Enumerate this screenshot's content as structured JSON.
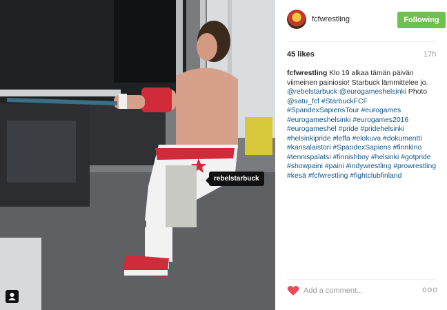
{
  "post": {
    "photo_alt": "",
    "photo_tag": "rebelstarbuck"
  },
  "header": {
    "username": "fcfwrestling",
    "follow_label": "Following"
  },
  "stats": {
    "likes": "45 likes",
    "time": "17h"
  },
  "caption": {
    "username": "fcfwrestling",
    "segments": [
      {
        "t": "text",
        "v": " Klo 19 alkaa tämän päivän viimeinen painiosio! Starbuck lämmittelee jo. "
      },
      {
        "t": "link",
        "v": "@rebelstarbuck"
      },
      {
        "t": "text",
        "v": " "
      },
      {
        "t": "link",
        "v": "@eurogameshelsinki"
      },
      {
        "t": "text",
        "v": " Photo "
      },
      {
        "t": "link",
        "v": "@satu_fcf"
      },
      {
        "t": "text",
        "v": " "
      },
      {
        "t": "link",
        "v": "#StarbuckFCF"
      },
      {
        "t": "text",
        "v": " "
      },
      {
        "t": "link",
        "v": "#SpandexSapiensTour"
      },
      {
        "t": "text",
        "v": " "
      },
      {
        "t": "link",
        "v": "#eurogames"
      },
      {
        "t": "text",
        "v": " "
      },
      {
        "t": "link",
        "v": "#eurogameshelsinki"
      },
      {
        "t": "text",
        "v": " "
      },
      {
        "t": "link",
        "v": "#eurogames2016"
      },
      {
        "t": "text",
        "v": " "
      },
      {
        "t": "link",
        "v": "#eurogameshel"
      },
      {
        "t": "text",
        "v": " "
      },
      {
        "t": "link",
        "v": "#pride"
      },
      {
        "t": "text",
        "v": " "
      },
      {
        "t": "link",
        "v": "#pridehelsinki"
      },
      {
        "t": "text",
        "v": " "
      },
      {
        "t": "link",
        "v": "#helsinkipride"
      },
      {
        "t": "text",
        "v": " "
      },
      {
        "t": "link",
        "v": "#leffa"
      },
      {
        "t": "text",
        "v": " "
      },
      {
        "t": "link",
        "v": "#elokuva"
      },
      {
        "t": "text",
        "v": " "
      },
      {
        "t": "link",
        "v": "#dokumentti"
      },
      {
        "t": "text",
        "v": " "
      },
      {
        "t": "link",
        "v": "#kansalaistori"
      },
      {
        "t": "text",
        "v": " "
      },
      {
        "t": "link",
        "v": "#SpandexSapiens"
      },
      {
        "t": "text",
        "v": " "
      },
      {
        "t": "link",
        "v": "#finnkino"
      },
      {
        "t": "text",
        "v": " "
      },
      {
        "t": "link",
        "v": "#tennispalatsi"
      },
      {
        "t": "text",
        "v": " "
      },
      {
        "t": "link",
        "v": "#finnishboy"
      },
      {
        "t": "text",
        "v": " "
      },
      {
        "t": "link",
        "v": "#helsinki"
      },
      {
        "t": "text",
        "v": " "
      },
      {
        "t": "link",
        "v": "#gotpride"
      },
      {
        "t": "text",
        "v": " "
      },
      {
        "t": "link",
        "v": "#showpaini"
      },
      {
        "t": "text",
        "v": " "
      },
      {
        "t": "link",
        "v": "#paini"
      },
      {
        "t": "text",
        "v": " "
      },
      {
        "t": "link",
        "v": "#indywrestling"
      },
      {
        "t": "text",
        "v": " "
      },
      {
        "t": "link",
        "v": "#prowrestling"
      },
      {
        "t": "text",
        "v": " "
      },
      {
        "t": "link",
        "v": "#kesä"
      },
      {
        "t": "text",
        "v": " "
      },
      {
        "t": "link",
        "v": "#fcfwrestling"
      },
      {
        "t": "text",
        "v": " "
      },
      {
        "t": "link",
        "v": "#fightclubfinland"
      }
    ]
  },
  "footer": {
    "comment_placeholder": "Add a comment...",
    "more_icon": "more-options-icon",
    "more_glyph": "ooo",
    "heart_icon": "heart-icon"
  },
  "colors": {
    "follow_bg": "#70c050",
    "link": "#125688",
    "heart": "#ed4956"
  }
}
